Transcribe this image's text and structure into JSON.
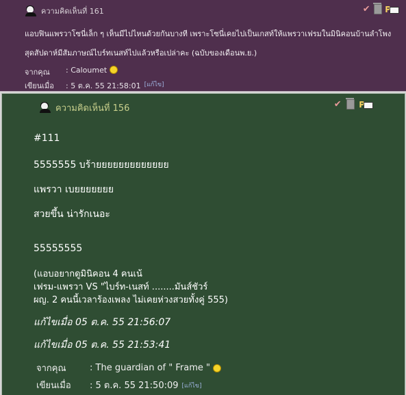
{
  "comment161": {
    "title": "ความคิดเห็นที่ 161",
    "body_line1": "แอบฟินแพรวาโซนี่เล็ก ๆ เห็นมีไปไหนด้วยกันบางที เพราะโซนี่เคยไปเป็นเกสท์ให้แพรวาเฟรมในมินิคอนบ้านลำโพง",
    "body_line2": "สุดสัปดาห์มีสัมภาษณ์ไบร์ทเนสท์ไปแล้วหรือเปล่าคะ (ฉบับของเดือนพ.ย.)",
    "from_label": "จากคุณ",
    "from_value": ": Caloumet",
    "posted_label": "เขียนเมื่อ",
    "posted_value": ": 5 ต.ค. 55 21:58:01",
    "edit_link": "[แก้ไข]"
  },
  "comment156": {
    "title": "ความคิดเห็นที่ 156",
    "l1": "#111",
    "l2": "5555555   บร้ายยยยยยยยยยยยย",
    "l3": "แพรวา   เบยยยยยยย",
    "l4": "สวยขึ้น น่ารักเนอะ",
    "l5": "55555555",
    "l6": "(แอบอยากดูมินิคอน 4 คนเน้",
    "l7": "เฟรม-แพรวา VS \"ไบร์ท-เนสท์ ........มันส์ชัวร์",
    "l8": "ผญ. 2 คนนี้เวลาร้องเพลง ไม่เคยห่วงสวยทั้งคู่  555)",
    "edit1": "แก้ไขเมื่อ 05 ต.ค. 55 21:56:07",
    "edit2": "แก้ไขเมื่อ 05 ต.ค. 55 21:53:41",
    "from_label": "จากคุณ",
    "from_value": ": The guardian of \" Frame \"",
    "posted_label": "เขียนเมื่อ",
    "posted_value": ": 5 ต.ค. 55 21:50:09",
    "edit_link": "[แก้ไข]"
  },
  "icons": [
    "user-avatar-icon",
    "check-vote-icon",
    "trash-icon",
    "private-message-icon",
    "smiley-icon"
  ]
}
